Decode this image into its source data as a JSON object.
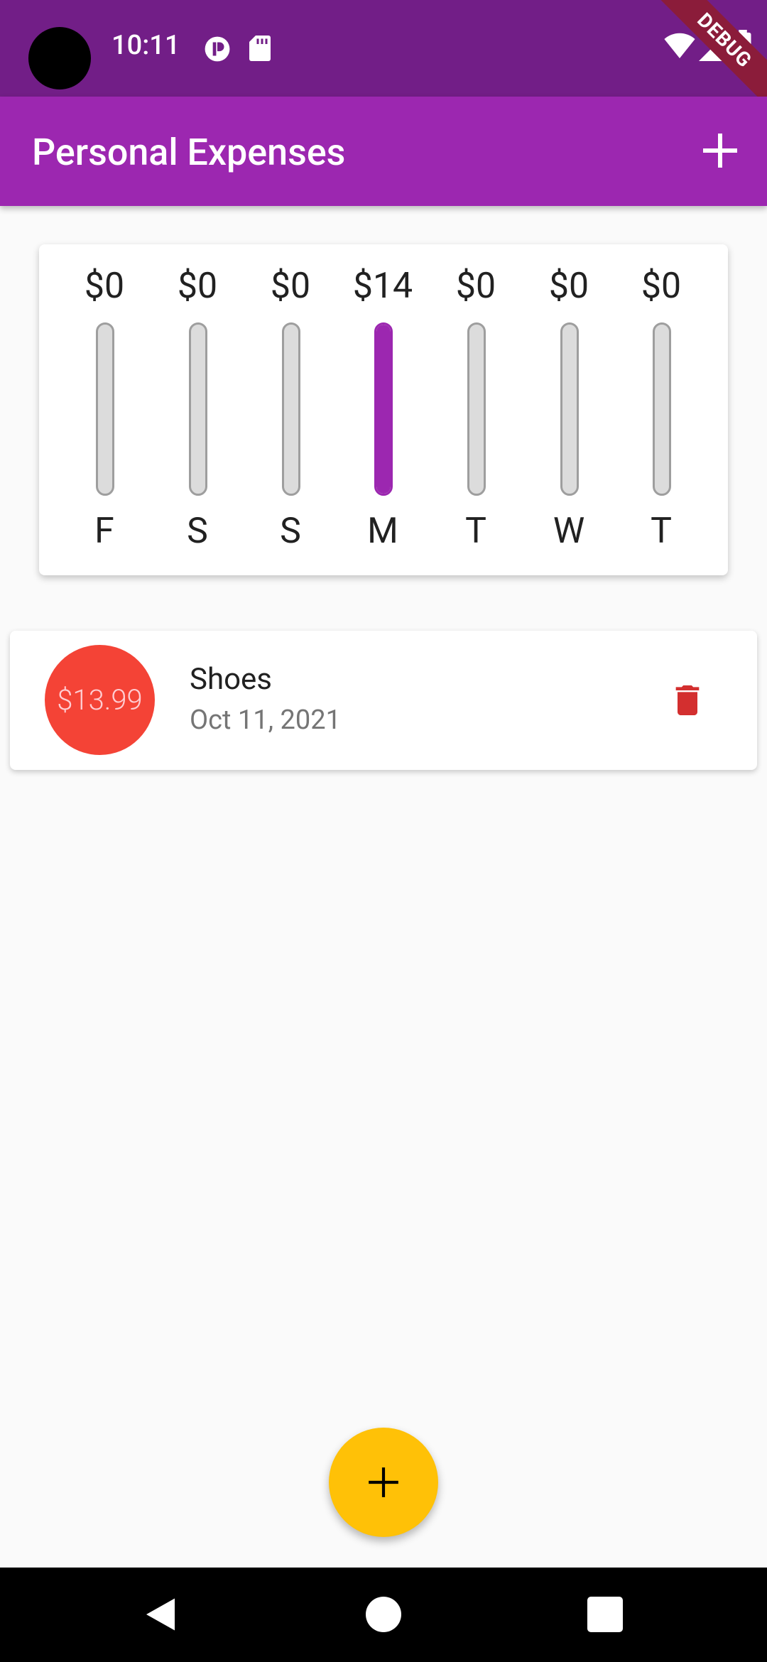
{
  "status_bar": {
    "time": "10:11",
    "icons": [
      "notification-icon",
      "sd-card-icon",
      "wifi-icon",
      "signal-icon",
      "battery-icon"
    ],
    "debug_label": "DEBUG"
  },
  "app_bar": {
    "title": "Personal Expenses",
    "add_icon": "plus-icon"
  },
  "chart": {
    "bars": [
      {
        "amount": "$0",
        "day": "F",
        "fraction": 0
      },
      {
        "amount": "$0",
        "day": "S",
        "fraction": 0
      },
      {
        "amount": "$0",
        "day": "S",
        "fraction": 0
      },
      {
        "amount": "$14",
        "day": "M",
        "fraction": 1
      },
      {
        "amount": "$0",
        "day": "T",
        "fraction": 0
      },
      {
        "amount": "$0",
        "day": "W",
        "fraction": 0
      },
      {
        "amount": "$0",
        "day": "T",
        "fraction": 0
      }
    ],
    "colors": {
      "fill": "#9c27b0",
      "track": "#dcdcdc"
    }
  },
  "transactions": [
    {
      "amount": "$13.99",
      "title": "Shoes",
      "date": "Oct 11, 2021",
      "delete_icon": "trash-icon"
    }
  ],
  "fab": {
    "icon": "plus-icon"
  },
  "colors": {
    "primary": "#9c27b0",
    "status_bar": "#721e87",
    "accent": "#ffc107",
    "error": "#f44336",
    "delete": "#d32f2f"
  },
  "nav": {
    "icons": [
      "back-icon",
      "home-icon",
      "recents-icon"
    ]
  }
}
